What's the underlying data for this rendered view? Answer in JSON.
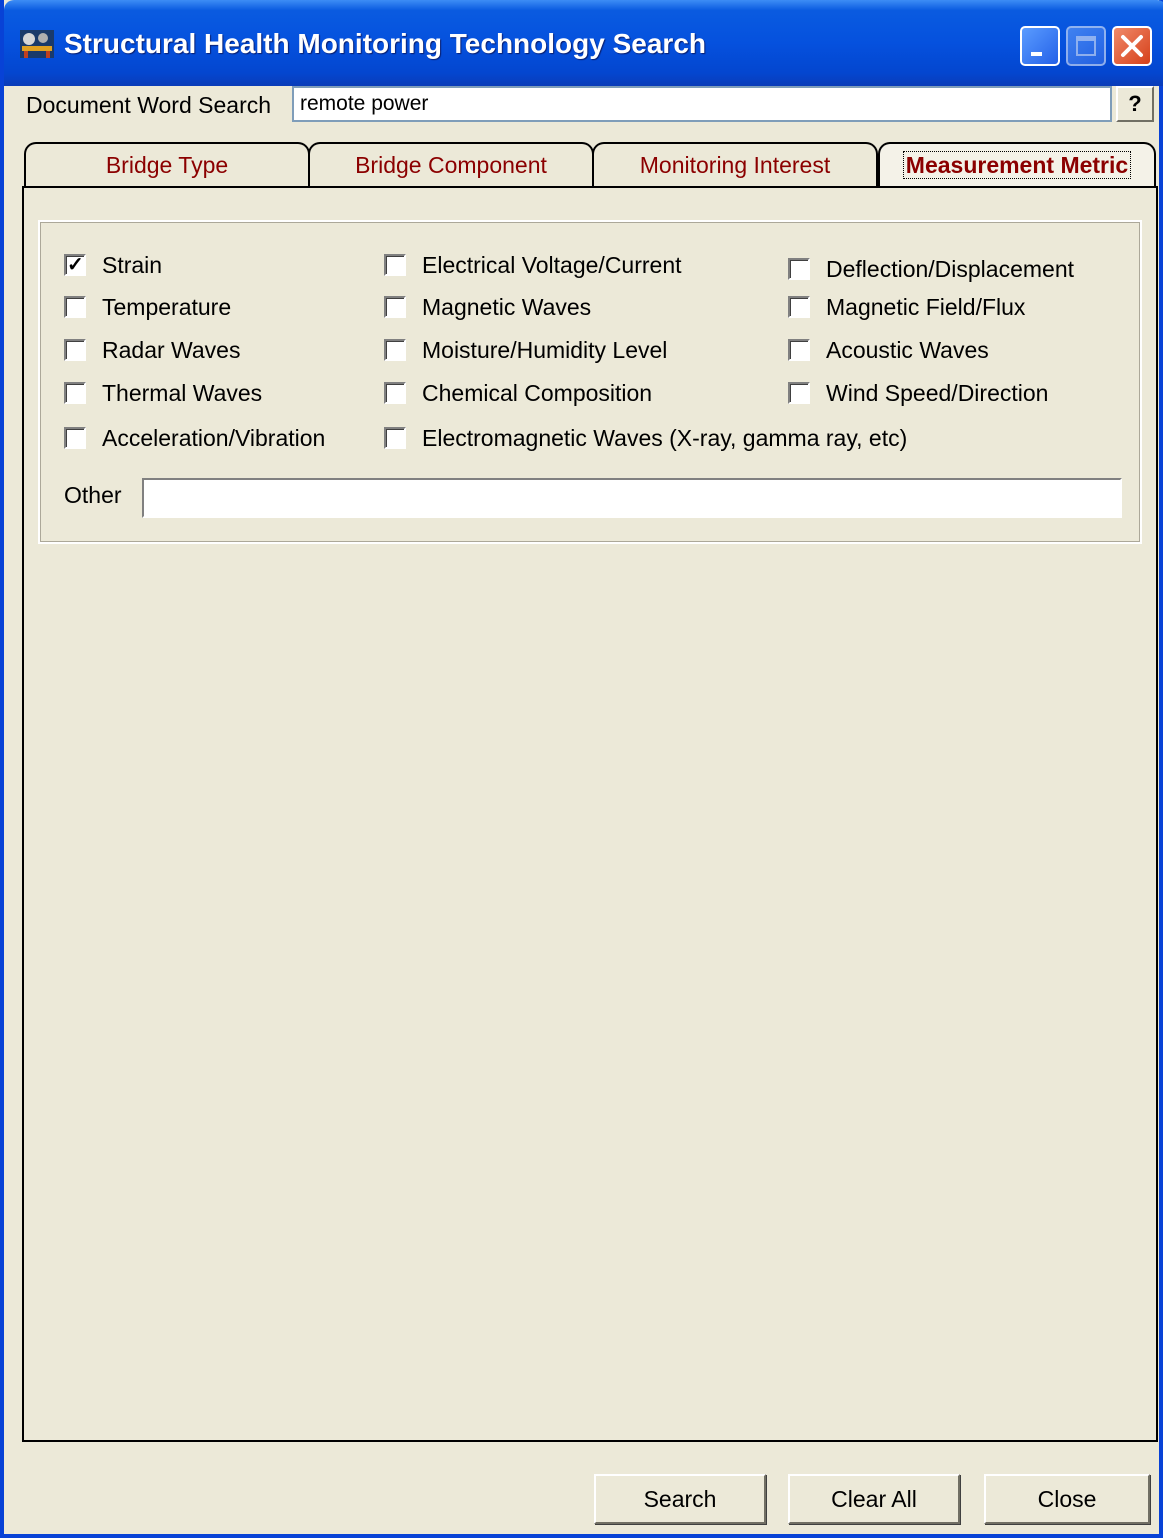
{
  "window": {
    "title": "Structural Health Monitoring Technology Search",
    "app_icon": "bridge-app-icon",
    "controls": [
      "minimize-icon",
      "maximize-icon",
      "close-icon"
    ]
  },
  "search": {
    "label": "Document Word Search",
    "value": "remote power",
    "help_label": "?"
  },
  "tabs": [
    {
      "label": "Bridge Type",
      "active": false
    },
    {
      "label": "Bridge Component",
      "active": false
    },
    {
      "label": "Monitoring Interest",
      "active": false
    },
    {
      "label": "Measurement Metric",
      "active": true
    }
  ],
  "metrics": {
    "col1": [
      {
        "label": "Strain",
        "checked": true
      },
      {
        "label": "Temperature",
        "checked": false
      },
      {
        "label": "Radar Waves",
        "checked": false
      },
      {
        "label": "Thermal Waves",
        "checked": false
      },
      {
        "label": "Acceleration/Vibration",
        "checked": false
      }
    ],
    "col2": [
      {
        "label": "Electrical Voltage/Current",
        "checked": false
      },
      {
        "label": "Magnetic Waves",
        "checked": false
      },
      {
        "label": "Moisture/Humidity Level",
        "checked": false
      },
      {
        "label": "Chemical Composition",
        "checked": false
      },
      {
        "label": "Electromagnetic Waves (X-ray, gamma ray, etc)",
        "checked": false
      }
    ],
    "col3": [
      {
        "label": "Deflection/Displacement",
        "checked": false
      },
      {
        "label": "Magnetic Field/Flux",
        "checked": false
      },
      {
        "label": "Acoustic Waves",
        "checked": false
      },
      {
        "label": "Wind Speed/Direction",
        "checked": false
      }
    ],
    "other_label": "Other",
    "other_value": ""
  },
  "buttons": {
    "search": "Search",
    "clear_all": "Clear All",
    "close": "Close"
  },
  "colors": {
    "tab_text": "#8b0000",
    "title_bar": "#0551de",
    "dialog_bg": "#ece9d8"
  }
}
